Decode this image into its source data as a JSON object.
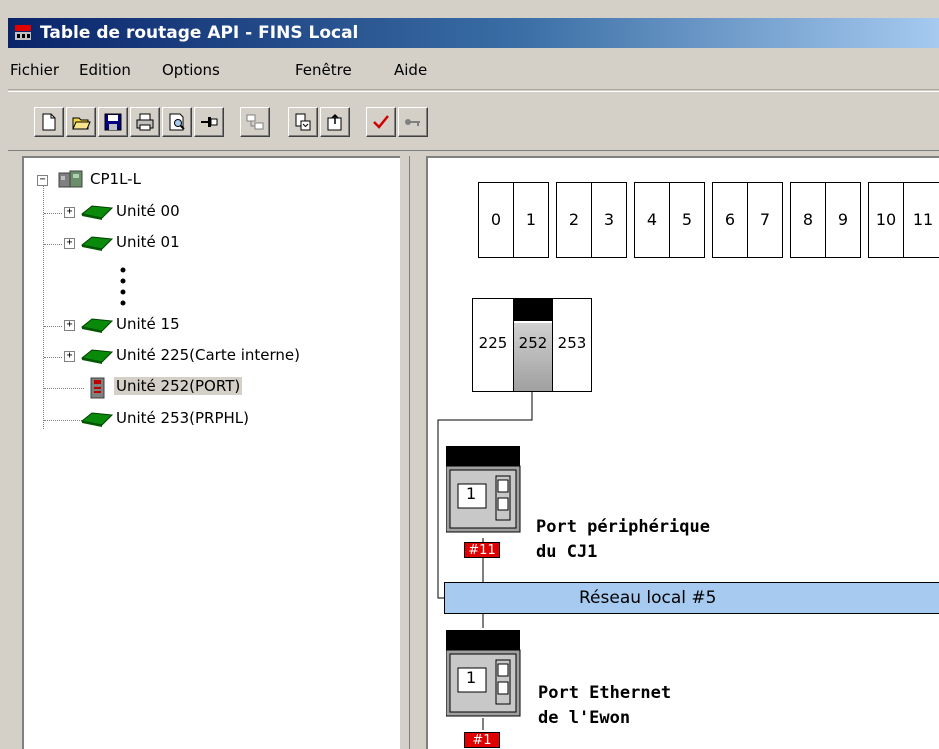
{
  "window": {
    "title": "Table de routage API - FINS Local",
    "title_color": "#0a246a"
  },
  "menu": [
    "Fichier",
    "Edition",
    "Options",
    "Fenêtre",
    "Aide"
  ],
  "toolbar": {
    "buttons": [
      "new-file-icon",
      "open-folder-icon",
      "save-icon",
      "print-icon",
      "print-preview-icon",
      "pin-icon",
      "transfer-icon",
      "upload-icon",
      "download-icon",
      "check-icon",
      "key-icon"
    ]
  },
  "tree": {
    "root": "CP1L-L",
    "items": [
      {
        "label": "Unité 00",
        "icon": "unit-icon"
      },
      {
        "label": "Unité 01",
        "icon": "unit-icon"
      },
      {
        "label": "Unité 15",
        "icon": "unit-icon"
      },
      {
        "label": "Unité 225(Carte interne)",
        "icon": "unit-icon"
      },
      {
        "label": "Unité 252(PORT)",
        "icon": "port-icon",
        "selected": true
      },
      {
        "label": "Unité 253(PRPHL)",
        "icon": "unit-icon"
      }
    ]
  },
  "diagram": {
    "unit_numbers": [
      "0",
      "1",
      "2",
      "3",
      "4",
      "5",
      "6",
      "7",
      "8",
      "9",
      "10",
      "11"
    ],
    "port_units": [
      "225",
      "252",
      "253"
    ],
    "network_label": "Réseau local #5",
    "network_color": "#a6caf0",
    "plc_top": {
      "slot": "1",
      "badge": "#11",
      "label_line1": "Port périphérique",
      "label_line2": "du CJ1"
    },
    "plc_bottom": {
      "slot": "1",
      "badge": "#1",
      "label_line1": "Port Ethernet",
      "label_line2": "de l'Ewon"
    },
    "badge_color": "#e00000"
  }
}
